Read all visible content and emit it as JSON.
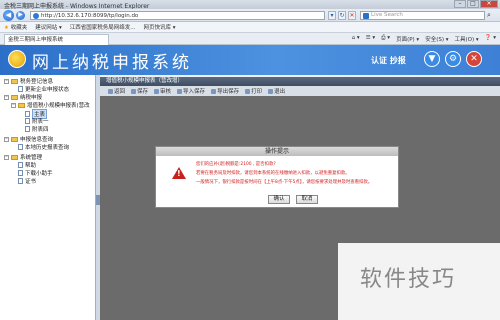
{
  "browser": {
    "title": "金税三期网上申报系统 - Windows Internet Explorer",
    "url": "http://10.32.6.170:8099/tp/login.do",
    "search_placeholder": "Live Search",
    "favorites_label": "收藏夹",
    "favorites": [
      "建议网站 ▾",
      "江西省国家税务局网络发...",
      "网页快讯库 ▾"
    ],
    "tab_label": "金税三期网上申报系统",
    "tools": [
      "页面(P) ▾",
      "安全(S) ▾",
      "工具(O) ▾",
      "❓ ▾"
    ]
  },
  "app": {
    "title": "网上纳税申报系统",
    "auth_label": "认证 抄报"
  },
  "sidebar": {
    "items": [
      {
        "label": "税务登记信息",
        "icon": "folder-icon"
      },
      {
        "label": "更新企业申报状态",
        "icon": "document-icon"
      },
      {
        "label": "纳税申报",
        "icon": "folder-icon"
      },
      {
        "label": "增值税小规模申报表(营改",
        "icon": "folder-icon"
      },
      {
        "label": "主表",
        "icon": "document-icon"
      },
      {
        "label": "附表一",
        "icon": "document-icon"
      },
      {
        "label": "附表四",
        "icon": "document-icon"
      },
      {
        "label": "申报信息查询",
        "icon": "folder-icon"
      },
      {
        "label": "本地历史报表查询",
        "icon": "document-icon"
      },
      {
        "label": "系统管理",
        "icon": "folder-icon"
      },
      {
        "label": "帮助",
        "icon": "document-icon"
      },
      {
        "label": "下载小助手",
        "icon": "document-icon"
      },
      {
        "label": "证书",
        "icon": "document-icon"
      }
    ]
  },
  "panel": {
    "title": "增值税小规模申报表（营改增）",
    "toolbar": [
      "返回",
      "保存",
      "审核",
      "导入保存",
      "导出保存",
      "打印",
      "退出"
    ]
  },
  "dialog": {
    "title": "操作提示",
    "messages": [
      "您们的应补(退)税额是:2100 , 是否扣款?",
      "若要在税务局及时扣款，请您到本系统的在线缴纳进入扣款，以避免重复扣款。",
      "一般情况下，银行扣款是按时间在【上午8点-下午5点】，请您按要求处理并及时查看扣款。"
    ],
    "ok_label": "确认",
    "cancel_label": "取消"
  },
  "watermark": "软件技巧",
  "colors": {
    "header_blue": "#2b6fc9",
    "alert_red": "#d21c1c",
    "overlay_gray": "#6b6b6b"
  }
}
